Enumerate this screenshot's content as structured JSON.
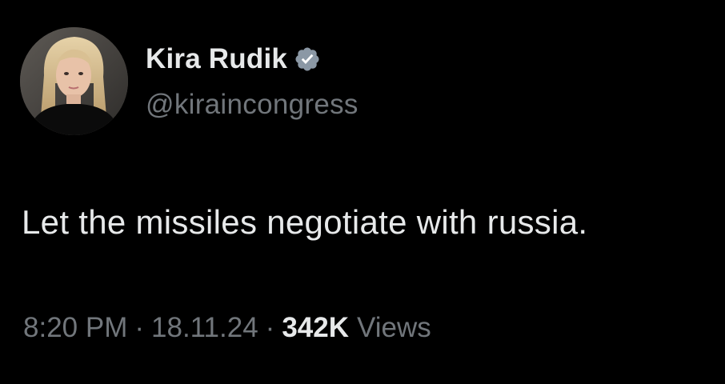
{
  "author": {
    "display_name": "Kira Rudik",
    "handle": "@kiraincongress",
    "verified_icon": "verified-badge-icon",
    "verified_color": "#8b98a5"
  },
  "tweet": {
    "text": "Let the missiles negotiate with russia.",
    "time": "8:20 PM",
    "date": "18.11.24",
    "separator": "·",
    "views_count": "342K",
    "views_label": "Views"
  },
  "colors": {
    "background": "#000000",
    "primary_text": "#e7e9ea",
    "secondary_text": "#71767b"
  }
}
